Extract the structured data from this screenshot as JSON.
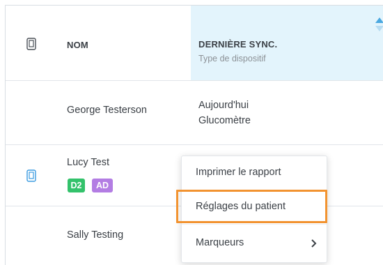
{
  "table": {
    "header": {
      "name_label": "NOM",
      "sync_label": "DERNIÈRE SYNC.",
      "sync_sublabel": "Type de dispositif",
      "device_icon": "device-icon",
      "sort_icon": "sort-arrows-icon"
    },
    "rows": [
      {
        "name": "George Testerson",
        "sync": "Aujourd'hui",
        "device_type": "Glucomètre",
        "has_device_icon": false,
        "badges": []
      },
      {
        "name": "Lucy Test",
        "sync": "",
        "device_type": "",
        "has_device_icon": true,
        "badges": [
          "D2",
          "AD"
        ]
      },
      {
        "name": "Sally Testing",
        "sync": "",
        "device_type": "",
        "has_device_icon": false,
        "badges": []
      }
    ]
  },
  "context_menu": {
    "items": [
      {
        "label": "Imprimer le rapport"
      },
      {
        "label": "Réglages du patient",
        "highlighted": true
      },
      {
        "label": "Marqueurs",
        "submenu_icon": "chevron-right-icon"
      }
    ]
  },
  "colors": {
    "sorted_column_bg": "#e3f4fc",
    "sort_arrow": "#4aa8e0",
    "device_icon_active": "#3b9be0",
    "badge_d2": "#33c26b",
    "badge_ad": "#b37de3",
    "highlight": "#f29330",
    "text": "#3b4046",
    "muted_text": "#8c9196"
  }
}
